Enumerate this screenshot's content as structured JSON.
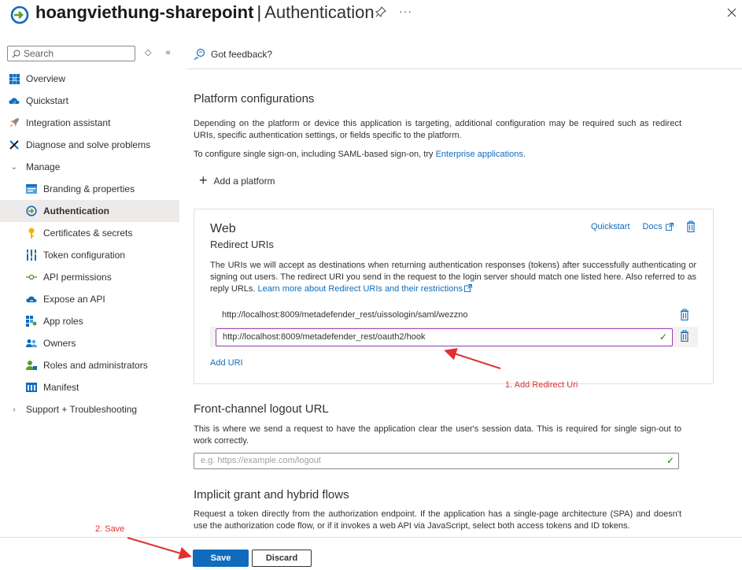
{
  "header": {
    "app_name": "hoangviethung-sharepoint",
    "separator": "|",
    "page_title": "Authentication",
    "more_label": "···"
  },
  "sidebar": {
    "search_placeholder": "Search",
    "items": [
      {
        "label": "Overview",
        "icon": "grid-icon"
      },
      {
        "label": "Quickstart",
        "icon": "cloud-icon"
      },
      {
        "label": "Integration assistant",
        "icon": "rocket-icon"
      },
      {
        "label": "Diagnose and solve problems",
        "icon": "wrench-icon"
      },
      {
        "label": "Manage",
        "icon": "chevron-down-icon"
      },
      {
        "label": "Branding & properties",
        "icon": "branding-icon"
      },
      {
        "label": "Authentication",
        "icon": "authentication-icon",
        "selected": true
      },
      {
        "label": "Certificates & secrets",
        "icon": "key-icon"
      },
      {
        "label": "Token configuration",
        "icon": "token-icon"
      },
      {
        "label": "API permissions",
        "icon": "api-permissions-icon"
      },
      {
        "label": "Expose an API",
        "icon": "cloud-api-icon"
      },
      {
        "label": "App roles",
        "icon": "app-roles-icon"
      },
      {
        "label": "Owners",
        "icon": "owners-icon"
      },
      {
        "label": "Roles and administrators",
        "icon": "roles-icon"
      },
      {
        "label": "Manifest",
        "icon": "manifest-icon"
      },
      {
        "label": "Support + Troubleshooting",
        "icon": "chevron-right-icon"
      }
    ]
  },
  "toolbar": {
    "feedback_label": "Got feedback?"
  },
  "platform": {
    "heading": "Platform configurations",
    "description": "Depending on the platform or device this application is targeting, additional configuration may be required such as redirect URIs, specific authentication settings, or fields specific to the platform.",
    "sso_text": "To configure single sign-on, including SAML-based sign-on, try ",
    "sso_link": "Enterprise applications",
    "sso_suffix": ".",
    "add_platform": "Add a platform"
  },
  "web": {
    "title": "Web",
    "subtitle": "Redirect URIs",
    "quickstart": "Quickstart",
    "docs": "Docs",
    "description": "The URIs we will accept as destinations when returning authentication responses (tokens) after successfully authenticating or signing out users. The redirect URI you send in the request to the login server should match one listed here. Also referred to as reply URLs. ",
    "learn_more": "Learn more about Redirect URIs and their restrictions",
    "uris": [
      "http://localhost:8009/metadefender_rest/uissologin/saml/wezzno",
      "http://localhost:8009/metadefender_rest/oauth2/hook"
    ],
    "add_uri": "Add URI"
  },
  "logout": {
    "heading": "Front-channel logout URL",
    "description": "This is where we send a request to have the application clear the user's session data. This is required for single sign-out to work correctly.",
    "placeholder": "e.g. https://example.com/logout"
  },
  "implicit": {
    "heading": "Implicit grant and hybrid flows",
    "description": "Request a token directly from the authorization endpoint. If the application has a single-page architecture (SPA) and doesn't use the authorization code flow, or if it invokes a web API via JavaScript, select both access tokens and ID tokens."
  },
  "footer": {
    "save": "Save",
    "discard": "Discard"
  },
  "annotations": {
    "step1": "1. Add Redirect Uri",
    "step2": "2. Save",
    "color": "#e03131"
  }
}
